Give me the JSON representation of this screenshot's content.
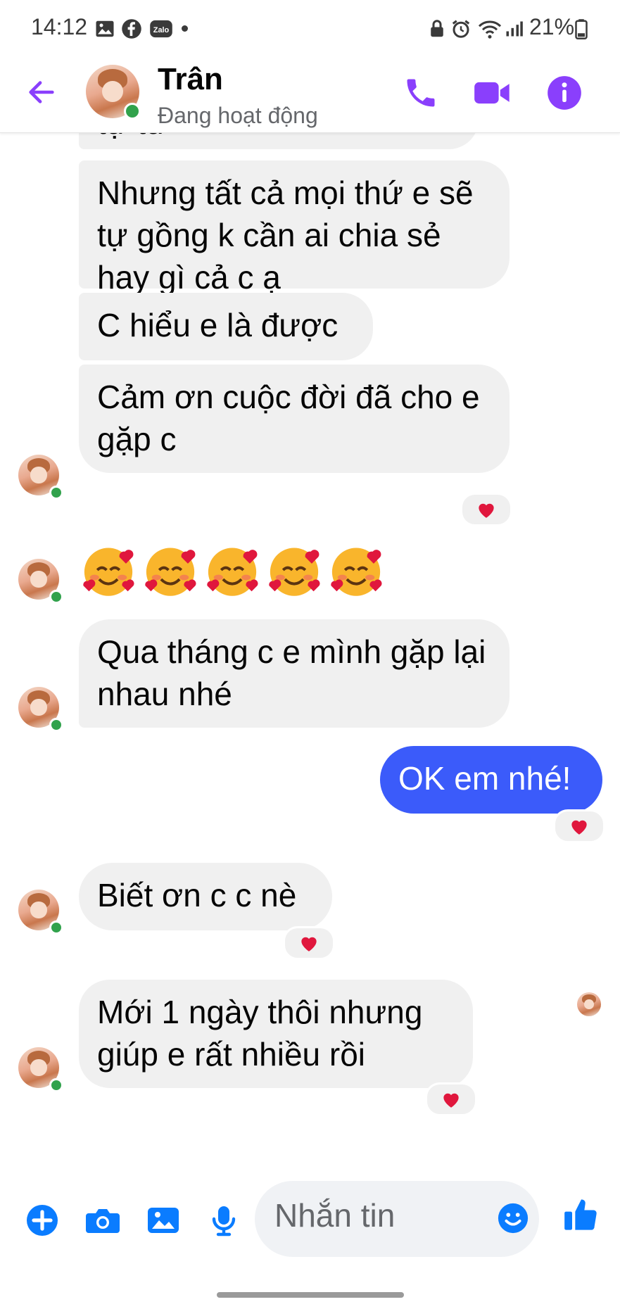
{
  "status_bar": {
    "time": "14:12",
    "battery": "21%",
    "notification_icons": [
      "gallery-icon",
      "facebook-icon",
      "zalo-icon"
    ],
    "system_icons": [
      "lock-icon",
      "alarm-icon",
      "wifi-icon",
      "signal-icon",
      "battery-icon"
    ],
    "zalo_text": "Zalo"
  },
  "header": {
    "contact_name": "Trân",
    "status": "Đang hoạt động",
    "accent_color": "#8a3ffc"
  },
  "messages": [
    {
      "from": "them",
      "text": "tự tu"
    },
    {
      "from": "them",
      "text": "Nhưng tất cả mọi thứ e sẽ tự gồng k cần ai chia sẻ hay gì cả c ạ"
    },
    {
      "from": "them",
      "text": "C hiểu e là được"
    },
    {
      "from": "them",
      "text": "Cảm ơn cuộc đời đã cho e gặp c",
      "reaction": "heart"
    },
    {
      "from": "them",
      "emoji": "smiling-face-with-hearts",
      "count": 5
    },
    {
      "from": "them",
      "text": "Qua tháng c e mình gặp lại nhau nhé"
    },
    {
      "from": "me",
      "text": "OK em nhé!",
      "reaction": "heart"
    },
    {
      "from": "them",
      "text": "Biết ơn c c nè",
      "reaction": "heart"
    },
    {
      "from": "them",
      "text": "Mới 1 ngày thôi nhưng giúp e rất nhiều rồi",
      "reaction": "heart"
    }
  ],
  "composer": {
    "placeholder": "Nhắn tin",
    "icons": [
      "add-icon",
      "camera-icon",
      "image-icon",
      "microphone-icon",
      "emoji-icon",
      "like-icon"
    ],
    "accent_color": "#0a7cff"
  }
}
